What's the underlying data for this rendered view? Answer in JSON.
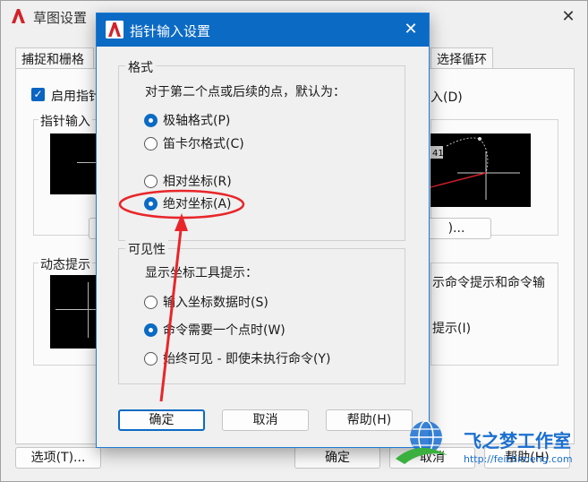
{
  "background_window": {
    "title": "草图设置",
    "tabs": [
      "捕捉和栅格",
      "选择循环"
    ],
    "enable_pointer_label": "启用指针",
    "enable_pointer_checked": true,
    "pointer_group_label": "指针输入",
    "dynamic_group_label": "动态提示",
    "right_text_1": "入(D)",
    "right_text_2": "示命令提示和命令输",
    "right_text_3": "提示(I)",
    "preview_button_right": ")...",
    "preview_badge": "41",
    "options_button": "选项(T)...",
    "ok_button": "确定",
    "cancel_button": "取消",
    "help_button": "帮助(H)"
  },
  "dialog": {
    "title": "指针输入设置",
    "format_group": {
      "label": "格式",
      "prompt": "对于第二个点或后续的点，默认为：",
      "options": [
        {
          "label": "极轴格式(P)",
          "checked": true
        },
        {
          "label": "笛卡尔格式(C)",
          "checked": false
        },
        {
          "label": "相对坐标(R)",
          "checked": false
        },
        {
          "label": "绝对坐标(A)",
          "checked": true
        }
      ]
    },
    "visibility_group": {
      "label": "可见性",
      "prompt": "显示坐标工具提示：",
      "options": [
        {
          "label": "输入坐标数据时(S)",
          "checked": false
        },
        {
          "label": "命令需要一个点时(W)",
          "checked": true
        },
        {
          "label": "始终可见 - 即使未执行命令(Y)",
          "checked": false
        }
      ]
    },
    "buttons": {
      "ok": "确定",
      "cancel": "取消",
      "help": "帮助(H)"
    }
  },
  "watermark": {
    "main": "飞之梦工作室",
    "url": "http://feizhimeng.com"
  },
  "colors": {
    "accent": "#0b6ac4",
    "annotation_red": "#e8262a"
  }
}
